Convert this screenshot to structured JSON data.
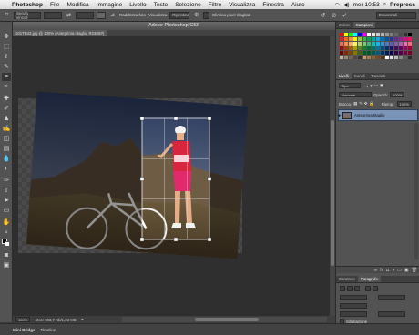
{
  "menubar": {
    "apple_icon": "apple-icon",
    "items": [
      "Photoshop",
      "File",
      "Modifica",
      "Immagine",
      "Livello",
      "Testo",
      "Selezione",
      "Filtro",
      "Visualizza",
      "Finestra",
      "Aiuto"
    ],
    "clock": "mer 10:53",
    "workspace": "Prepress"
  },
  "optbar": {
    "preset": "Senza vincoli",
    "ratio_w": "",
    "ratio_h": "",
    "straighten": "Raddrizza foto",
    "view": "Visualizza",
    "btn_reset": "Ripristina",
    "delete_pixels": "Elimina pixel ritagliati",
    "label_hint": "Essenziali"
  },
  "window": {
    "title": "Adobe Photoshop CS6",
    "doc_tab": "101TB43.jpg @ 100% (Anteprima ritaglio, RGB/8#)"
  },
  "status": {
    "zoom": "100%",
    "doc": "Doc: 903,7 Kb/1,23 MB"
  },
  "bottom": {
    "tabs": [
      "Mini Bridge",
      "Timeline"
    ]
  },
  "panels": {
    "color_tabs": [
      "Colore",
      "Campioni"
    ],
    "layers_tabs": [
      "Livelli",
      "Canali",
      "Tracciati"
    ],
    "filter_label": "Tipo",
    "blend_mode": "Normale",
    "opacity_label": "Opacità:",
    "opacity_value": "100%",
    "lock_label": "Blocca:",
    "fill_label": "Riemp.:",
    "fill_value": "100%",
    "layer_name": "Anteprima ritaglio",
    "char_tabs": [
      "Carattere",
      "Paragrafo"
    ],
    "hyphen_label": "Sillabazione"
  },
  "swatches": [
    [
      "#ff0000",
      "#ffff00",
      "#00ff00",
      "#00ffff",
      "#0000ff",
      "#ff00ff",
      "#ffffff",
      "#e6e6e6",
      "#cccccc",
      "#b3b3b3",
      "#999999",
      "#808080",
      "#666666",
      "#4d4d4d",
      "#333333",
      "#000000"
    ],
    [
      "#ed1c24",
      "#f26522",
      "#f7941d",
      "#fff200",
      "#8dc63f",
      "#39b54a",
      "#00a651",
      "#00a99d",
      "#00aeef",
      "#0072bc",
      "#0054a6",
      "#2e3192",
      "#662d91",
      "#92278f",
      "#ec008c",
      "#ed145b"
    ],
    [
      "#f26c4f",
      "#f68e55",
      "#fbaf5c",
      "#fff467",
      "#acd372",
      "#7cc576",
      "#3bb878",
      "#1abbb4",
      "#00bff3",
      "#438ccb",
      "#5574b9",
      "#605ca8",
      "#855fa8",
      "#a763a8",
      "#f06ea9",
      "#f26d7d"
    ],
    [
      "#9e0b0f",
      "#a0410d",
      "#a36209",
      "#aba000",
      "#598527",
      "#1a7b30",
      "#007236",
      "#00746b",
      "#0076a3",
      "#004b80",
      "#003471",
      "#1b1464",
      "#440e62",
      "#630460",
      "#9e005d",
      "#9e0039"
    ],
    [
      "#790000",
      "#7b2e00",
      "#7d4900",
      "#827b00",
      "#406618",
      "#005e20",
      "#005826",
      "#005952",
      "#005b7f",
      "#003663",
      "#002157",
      "#0d004c",
      "#32004b",
      "#4b0049",
      "#7b0046",
      "#7a0026"
    ],
    [
      "#c7b299",
      "#998675",
      "#736357",
      "#534741",
      "#37302a",
      "#c69c6d",
      "#a67c52",
      "#8c6239",
      "#754c24",
      "#603913",
      "#ffffff",
      "#e0e0e0",
      "#bdbdbd",
      "#8a8a8a",
      "#5c5c5c",
      "#2b2b2b"
    ]
  ]
}
